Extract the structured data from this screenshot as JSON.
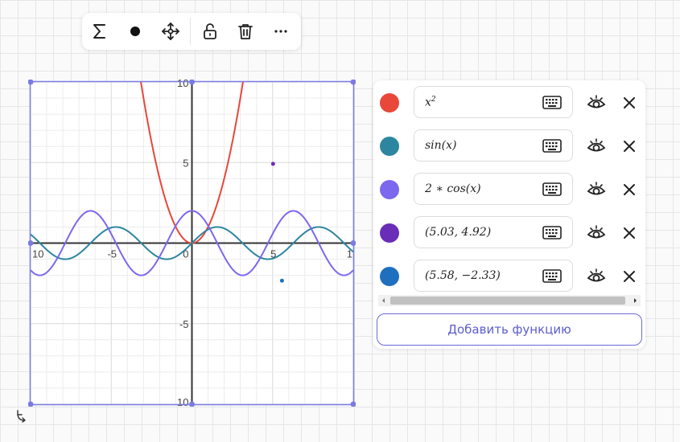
{
  "toolbar": {
    "buttons": [
      {
        "name": "sigma-button",
        "icon": "sigma-icon"
      },
      {
        "name": "point-button",
        "icon": "dot-icon"
      },
      {
        "name": "move-button",
        "icon": "move-arrows-icon"
      },
      {
        "name": "lock-button",
        "icon": "unlock-icon"
      },
      {
        "name": "delete-button",
        "icon": "trash-icon"
      },
      {
        "name": "more-button",
        "icon": "ellipsis-icon"
      }
    ]
  },
  "graph": {
    "x_tick_labels": [
      "10",
      "-5",
      "0",
      "5",
      "1"
    ],
    "y_tick_labels": [
      "10",
      "5",
      "-5",
      "10"
    ],
    "axis_color": "#333333",
    "selection_color": "#7b7be6"
  },
  "chart_data": {
    "type": "line",
    "xlim": [
      -10,
      10
    ],
    "ylim": [
      -10,
      10
    ],
    "grid": true,
    "series": [
      {
        "expr": "x^2",
        "color": "#e8473a"
      },
      {
        "expr": "sin(x)",
        "color": "#2d86a0"
      },
      {
        "expr": "2*cos(x)",
        "color": "#7b68ee"
      }
    ],
    "points": [
      {
        "x": 5.03,
        "y": 4.92,
        "color": "#6a2db8"
      },
      {
        "x": 5.58,
        "y": -2.33,
        "color": "#1f6fbf"
      }
    ]
  },
  "functions": [
    {
      "expr_html": "x<sup>2</sup>",
      "color": "#e8473a"
    },
    {
      "expr_html": "sin(x)",
      "color": "#2d86a0"
    },
    {
      "expr_html": "2 ∗ cos(x)",
      "color": "#7b68ee"
    },
    {
      "expr_html": "(5.03, 4.92)",
      "color": "#6a2db8"
    },
    {
      "expr_html": "(5.58, −2.33)",
      "color": "#1f6fbf"
    }
  ],
  "add_button_label": "Добавить функцию"
}
